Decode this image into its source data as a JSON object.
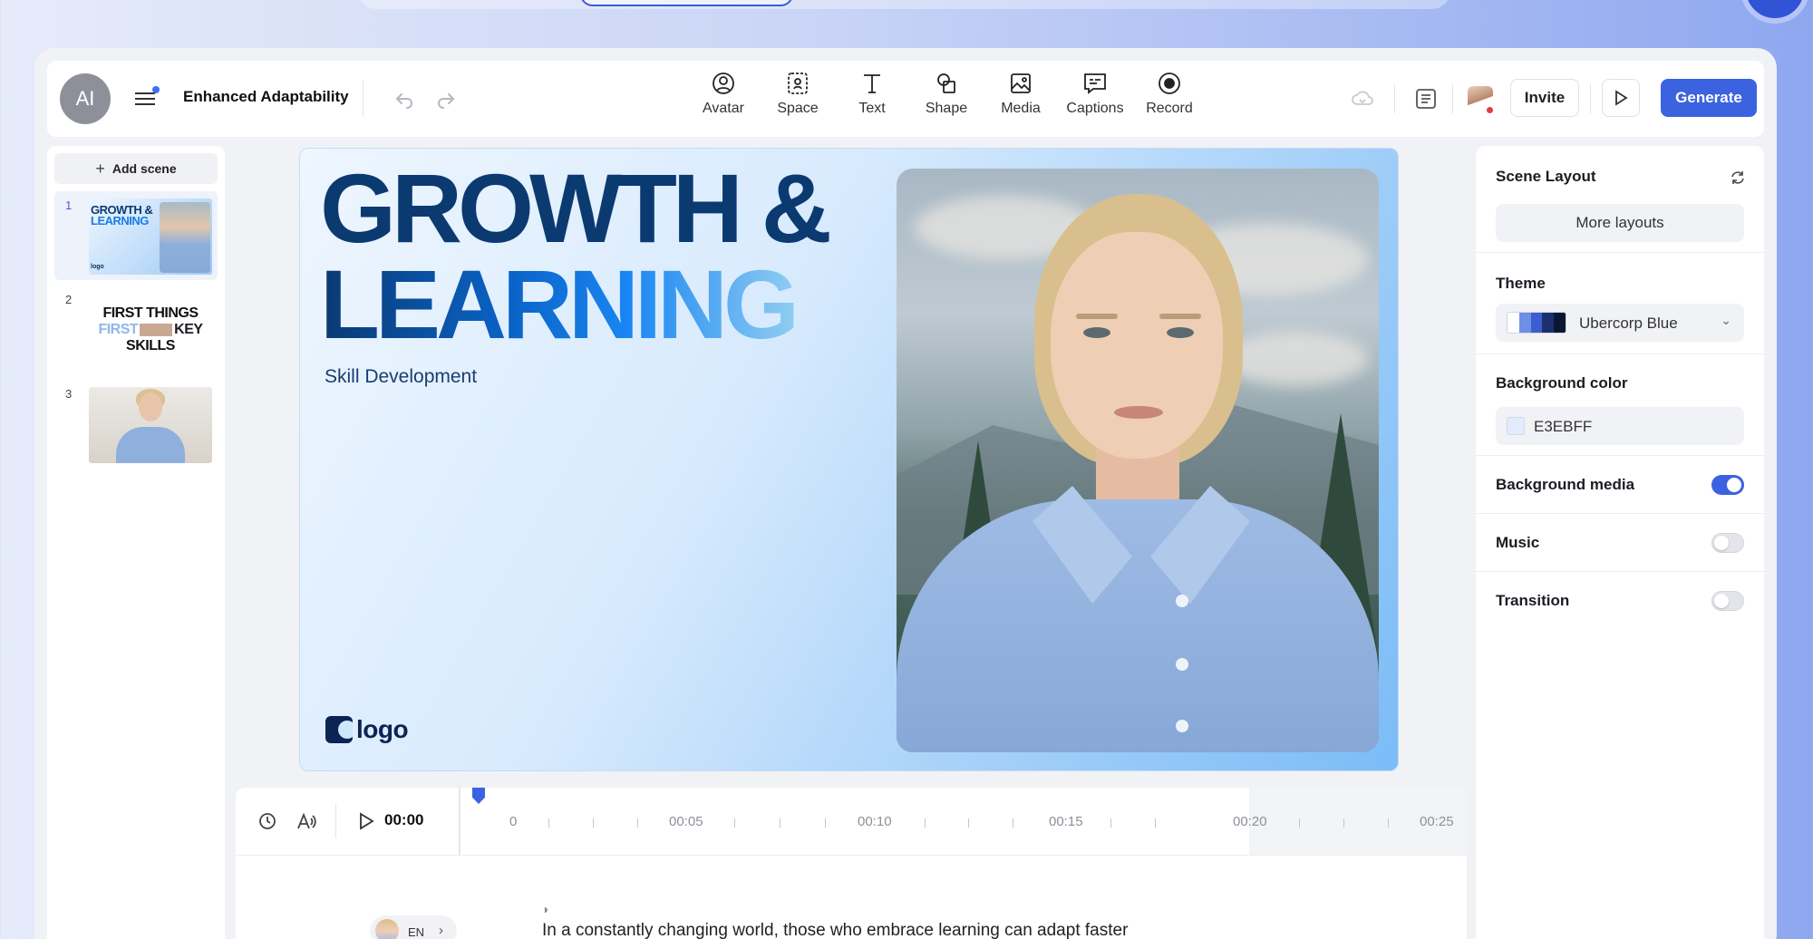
{
  "header": {
    "avatar_initials": "AI",
    "project_title": "Enhanced Adaptability",
    "tools": [
      {
        "label": "Avatar",
        "icon": "avatar-icon"
      },
      {
        "label": "Space",
        "icon": "space-icon"
      },
      {
        "label": "Text",
        "icon": "text-icon"
      },
      {
        "label": "Shape",
        "icon": "shape-icon"
      },
      {
        "label": "Media",
        "icon": "media-icon"
      },
      {
        "label": "Captions",
        "icon": "captions-icon"
      },
      {
        "label": "Record",
        "icon": "record-icon"
      }
    ],
    "invite_label": "Invite",
    "generate_label": "Generate"
  },
  "scenes": {
    "add_label": "Add scene",
    "items": [
      {
        "number": "1",
        "title_line1": "GROWTH &",
        "title_line2": "LEARNING",
        "logo": "logo"
      },
      {
        "number": "2",
        "line1": "FIRST THINGS",
        "line2a": "FIRST",
        "line2b": "KEY",
        "line3": "SKILLS"
      },
      {
        "number": "3"
      }
    ]
  },
  "canvas": {
    "title_line1": "GROWTH &",
    "title_line2": "LEARNING",
    "subtitle": "Skill Development",
    "logo_text": "logo"
  },
  "timeline": {
    "current_time": "00:00",
    "labels": [
      "0",
      "00:05",
      "00:10",
      "00:15",
      "00:20",
      "00:25"
    ]
  },
  "script": {
    "language": "EN",
    "text": "In a constantly changing world, those who embrace learning can adapt faster"
  },
  "right_panel": {
    "scene_layout_label": "Scene Layout",
    "more_layouts_label": "More layouts",
    "theme_label": "Theme",
    "theme_name": "Ubercorp Blue",
    "theme_colors": [
      "#ffffff",
      "#6f8ee6",
      "#3b5dd0",
      "#1c2f6e",
      "#0b1633"
    ],
    "background_color_label": "Background color",
    "background_color_value": "E3EBFF",
    "background_color_hex": "#E3EBFF",
    "background_media_label": "Background media",
    "background_media_on": true,
    "music_label": "Music",
    "music_on": false,
    "transition_label": "Transition",
    "transition_on": false
  },
  "colors": {
    "accent": "#3b63e0",
    "title_dark": "#0b3a71"
  }
}
